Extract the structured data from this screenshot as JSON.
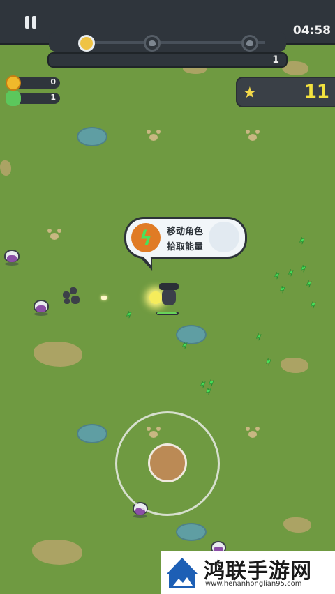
{
  "hud": {
    "timer": "04:58",
    "xp_value": "1",
    "coins": "0",
    "kills": "1",
    "score": "11",
    "wave_progress": 0
  },
  "tooltip": {
    "line1": "移动角色",
    "line2": "拾取能量"
  },
  "watermark": {
    "title": "鸿联手游网",
    "url": "www.henanhonglian95.com"
  },
  "colors": {
    "grass": "#6f9a41",
    "hud_dark": "#2f353c",
    "score_yellow": "#f3e23f",
    "joystick_knob": "#bb8a55",
    "energy_green": "#4ae05b"
  },
  "icons": [
    "pause-icon",
    "coin-icon",
    "skull-icon",
    "star-icon",
    "lightning-icon",
    "boss-skull-icon"
  ]
}
